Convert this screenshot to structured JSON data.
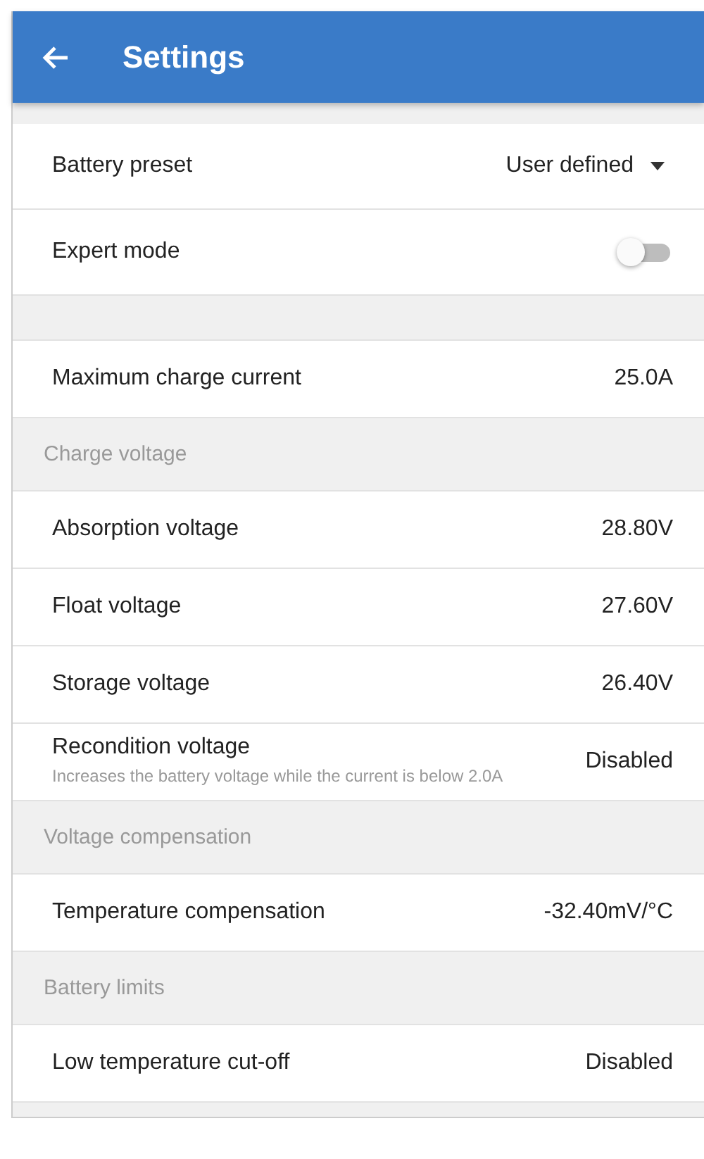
{
  "app_bar": {
    "title": "Settings"
  },
  "items": [
    {
      "kind": "dropdown",
      "label": "Battery preset",
      "value": "User defined"
    },
    {
      "kind": "toggle",
      "label": "Expert mode",
      "on": false
    },
    {
      "kind": "spacer"
    },
    {
      "kind": "value",
      "label": "Maximum charge current",
      "value": "25.0A"
    },
    {
      "kind": "section",
      "label": "Charge voltage"
    },
    {
      "kind": "value",
      "label": "Absorption voltage",
      "value": "28.80V"
    },
    {
      "kind": "value",
      "label": "Float voltage",
      "value": "27.60V"
    },
    {
      "kind": "value",
      "label": "Storage voltage",
      "value": "26.40V"
    },
    {
      "kind": "value",
      "label": "Recondition voltage",
      "description": "Increases the battery voltage while the current is below 2.0A",
      "value": "Disabled"
    },
    {
      "kind": "section",
      "label": "Voltage compensation"
    },
    {
      "kind": "value",
      "label": "Temperature compensation",
      "value": "-32.40mV/°C"
    },
    {
      "kind": "section",
      "label": "Battery limits"
    },
    {
      "kind": "value",
      "label": "Low temperature cut-off",
      "value": "Disabled"
    }
  ]
}
